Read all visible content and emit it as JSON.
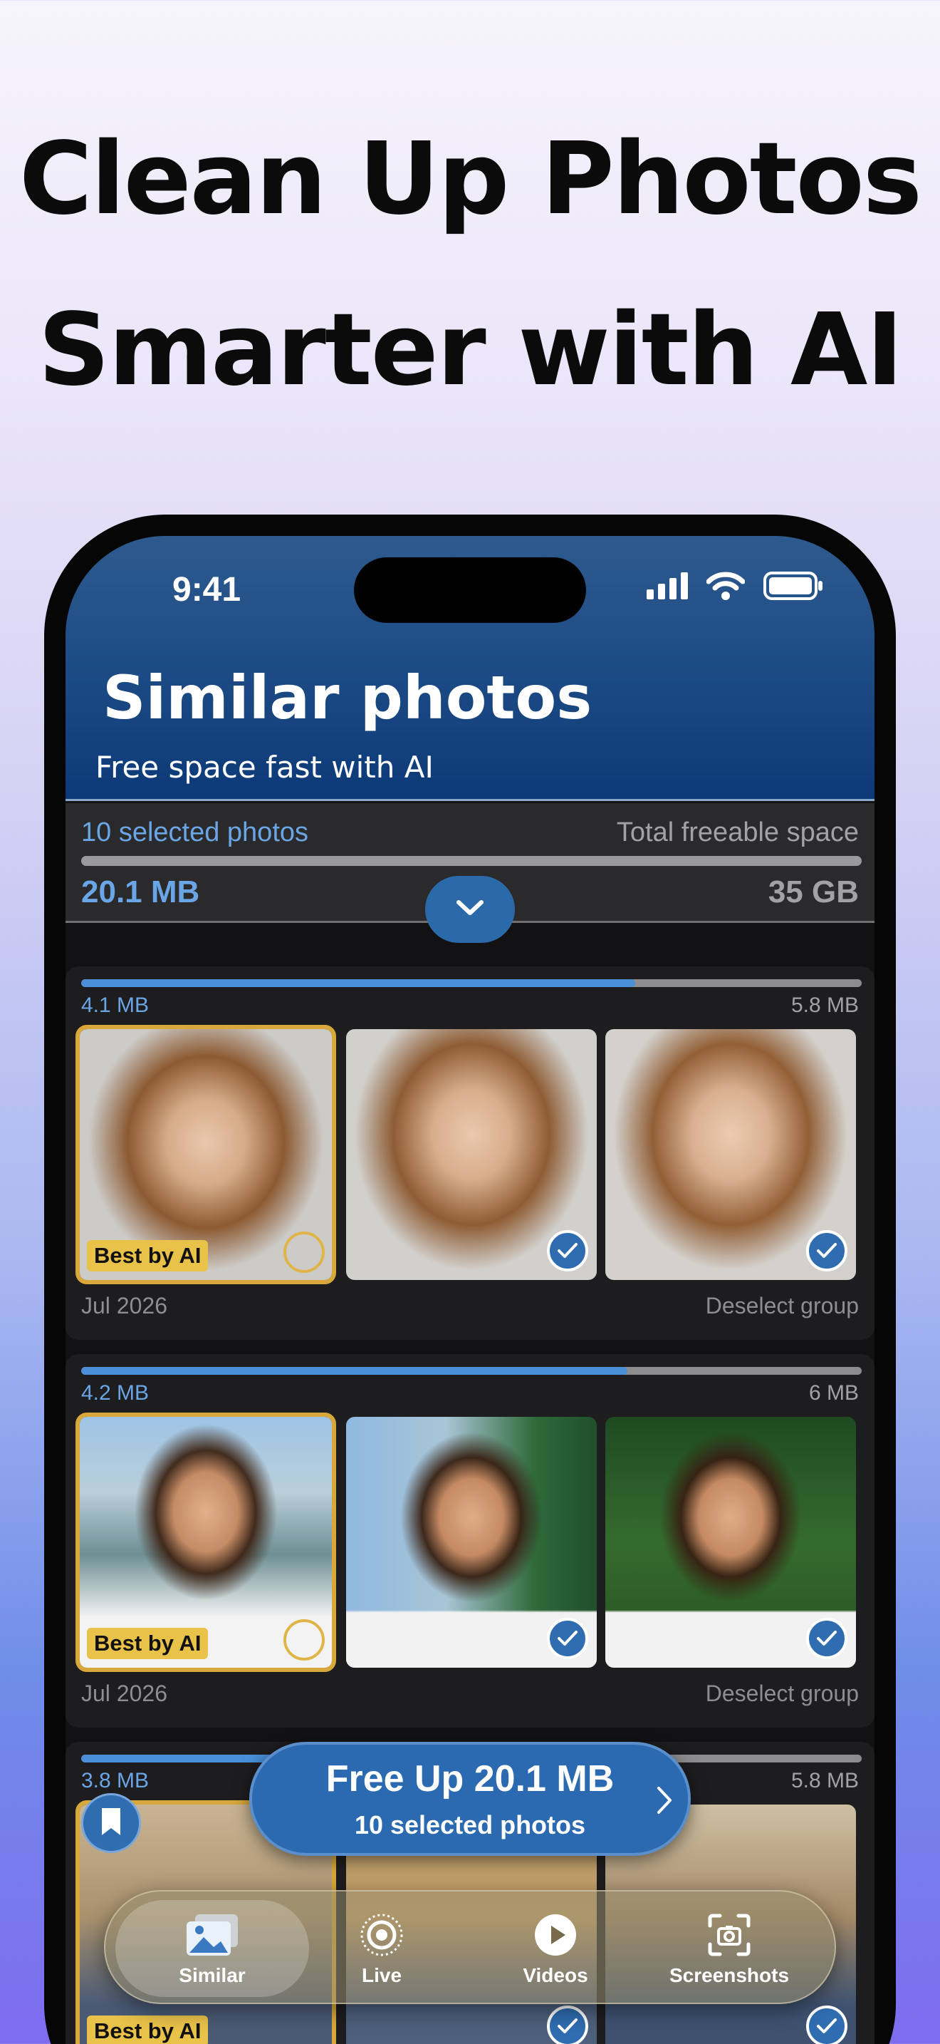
{
  "headline": {
    "line1": "Clean Up Photos",
    "line2": "Smarter with AI"
  },
  "status_bar": {
    "time": "9:41",
    "icons": [
      "signal-icon",
      "wifi-icon",
      "battery-icon"
    ]
  },
  "header": {
    "title": "Similar photos",
    "subtitle": "Free space fast with AI"
  },
  "summary": {
    "selected_label": "10 selected photos",
    "total_label": "Total freeable space",
    "selected_size": "20.1 MB",
    "total_size": "35 GB"
  },
  "groups": [
    {
      "size_selected": "4.1 MB",
      "size_total": "5.8 MB",
      "progress": 0.71,
      "best_label": "Best by AI",
      "date": "Jul 2026",
      "deselect_label": "Deselect group"
    },
    {
      "size_selected": "4.2 MB",
      "size_total": "6 MB",
      "progress": 0.7,
      "best_label": "Best by AI",
      "date": "Jul 2026",
      "deselect_label": "Deselect group"
    },
    {
      "size_selected": "3.8 MB",
      "size_total": "5.8 MB",
      "progress": 0.66,
      "best_label": "Best by AI"
    }
  ],
  "free_up_button": {
    "title": "Free Up 20.1 MB",
    "subtitle": "10 selected photos"
  },
  "tabs": [
    {
      "label": "Similar",
      "icon": "photos-icon",
      "active": true
    },
    {
      "label": "Live",
      "icon": "live-icon"
    },
    {
      "label": "Videos",
      "icon": "play-icon"
    },
    {
      "label": "Screenshots",
      "icon": "screenshot-icon"
    }
  ],
  "colors": {
    "accent": "#2b6ab0",
    "best_highlight": "#d8a93a",
    "size_text": "#6aa6e6"
  }
}
